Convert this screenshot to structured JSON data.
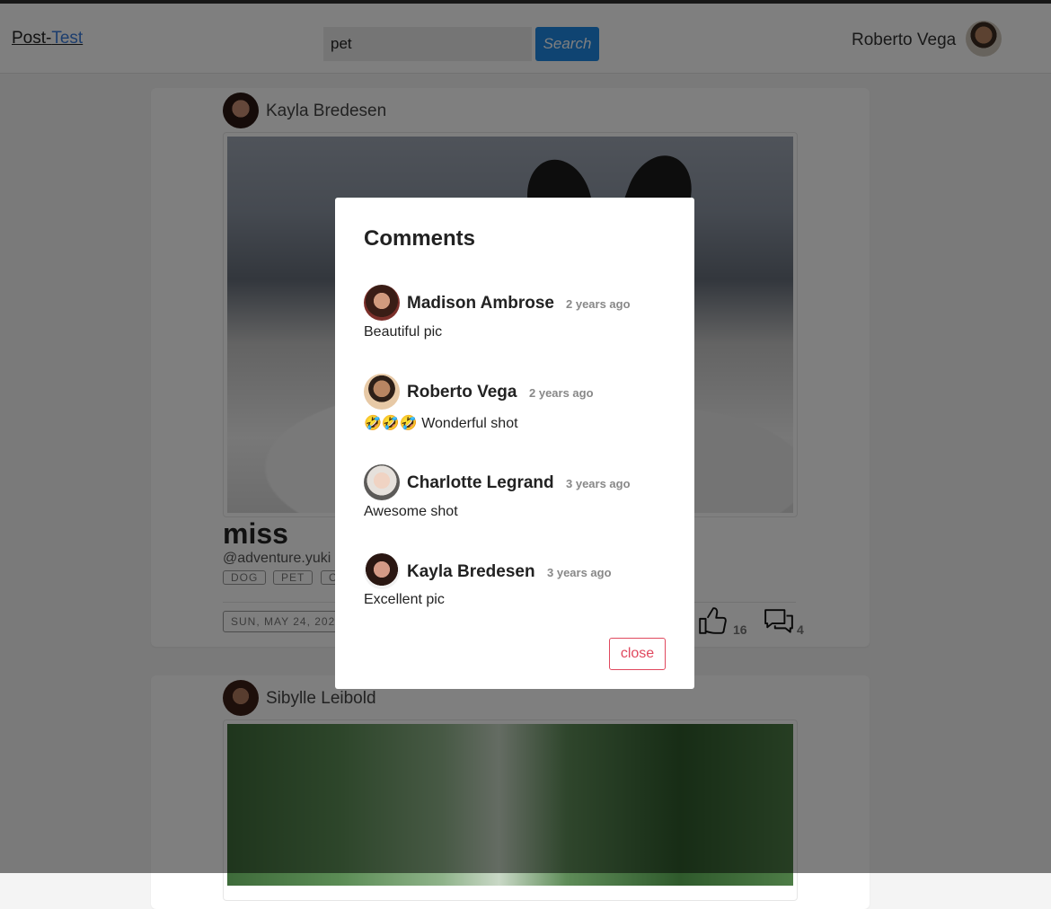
{
  "navbar": {
    "brand_part1": "Post-",
    "brand_part2": "Test",
    "search_value": "pet",
    "search_button": "Search",
    "user_name": "Roberto Vega"
  },
  "posts": [
    {
      "author": "Kayla Bredesen",
      "title": "miss",
      "handle": "@adventure.yuki",
      "tags": [
        "DOG",
        "PET",
        "C"
      ],
      "date": "SUN, MAY 24, 202",
      "likes": "16",
      "comments": "4"
    },
    {
      "author": "Sibylle Leibold"
    }
  ],
  "modal": {
    "title": "Comments",
    "close_label": "close",
    "comments": [
      {
        "name": "Madison Ambrose",
        "time": "2 years ago",
        "text": "Beautiful pic"
      },
      {
        "name": "Roberto Vega",
        "time": "2 years ago",
        "text": "🤣🤣🤣 Wonderful shot"
      },
      {
        "name": "Charlotte Legrand",
        "time": "3 years ago",
        "text": "Awesome shot"
      },
      {
        "name": "Kayla Bredesen",
        "time": "3 years ago",
        "text": "Excellent pic"
      }
    ]
  },
  "icons": {
    "like": "thumbs-up-icon",
    "comment": "comments-icon"
  }
}
